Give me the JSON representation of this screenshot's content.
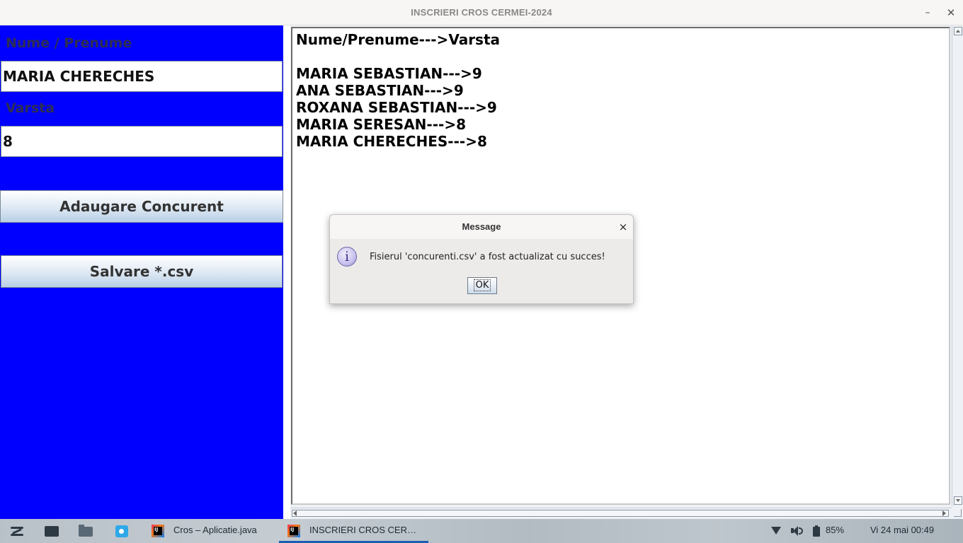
{
  "window": {
    "title": "INSCRIERI CROS CERMEI-2024",
    "minimize_glyph": "–",
    "close_glyph": "✕"
  },
  "form": {
    "name_label": "Nume / Prenume",
    "name_value": "MARIA CHERECHES",
    "age_label": "Varsta",
    "age_value": "8",
    "add_button": "Adaugare Concurent",
    "save_button": "Salvare *.csv"
  },
  "output": {
    "header": "Nume/Prenume--->Varsta",
    "entries": [
      "MARIA SEBASTIAN--->9",
      "ANA SEBASTIAN--->9",
      "ROXANA SEBASTIAN--->9",
      "MARIA SERESAN--->8",
      "MARIA CHERECHES--->8"
    ]
  },
  "dialog": {
    "title": "Message",
    "close_glyph": "×",
    "icon": "info-icon",
    "icon_glyph": "i",
    "message": "Fisierul 'concurenti.csv' a fost actualizat cu succes!",
    "ok_label": "OK"
  },
  "taskbar": {
    "apps": [
      {
        "label": "Cros – Aplicatie.java",
        "icon": "intellij-icon",
        "active": false
      },
      {
        "label": "INSCRIERI CROS CER…",
        "icon": "intellij-icon",
        "active": true
      }
    ],
    "ij_glyph": "IJ",
    "battery": "85%",
    "datetime": "Vi 24 mai   00:49"
  },
  "colors": {
    "left_panel": "#0000ff",
    "label_text": "#2e2e52",
    "active_indicator": "#1a5fb4"
  }
}
